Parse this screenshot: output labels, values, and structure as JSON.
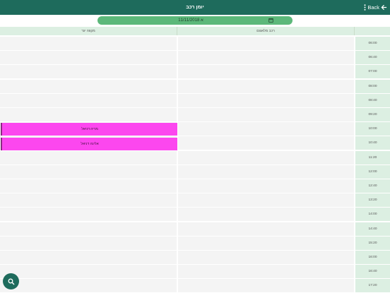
{
  "header": {
    "title": "יומן רכב",
    "back_label": "Back"
  },
  "date_bar": {
    "date": "11/11/2018 א"
  },
  "columns": [
    "מקווה יגר",
    "רכב מלאגום"
  ],
  "times": [
    "06:00",
    "06:40",
    "07:00",
    "08:00",
    "08:40",
    "09:20",
    "10:00",
    "10:40",
    "11:20",
    "12:00",
    "12:40",
    "13:20",
    "14:00",
    "14:40",
    "15:20",
    "16:00",
    "16:40",
    "17:20"
  ],
  "events": [
    {
      "label": "מריה דניאל"
    },
    {
      "label": "אלינה דניאל"
    }
  ],
  "colors": {
    "primary": "#1e6b5c",
    "accent": "#5cb87a",
    "event": "#fc47ef",
    "header_bg": "#dcefe2"
  }
}
